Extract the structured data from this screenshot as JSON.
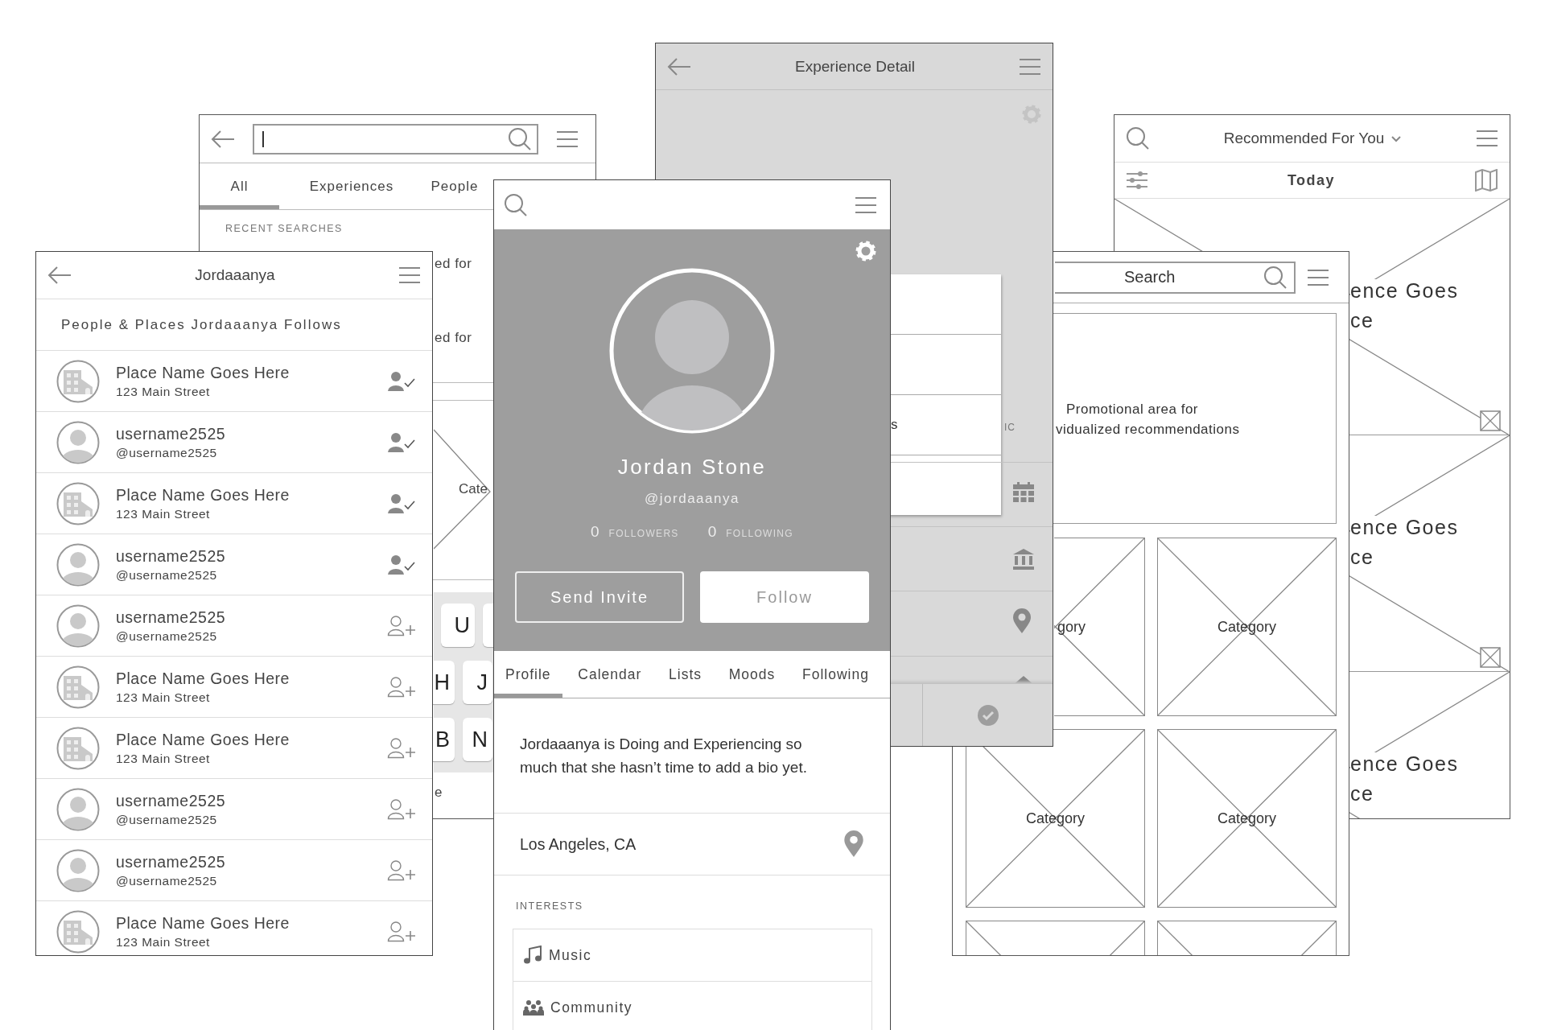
{
  "search_screen": {
    "tabs": [
      {
        "label": "All",
        "selected": true
      },
      {
        "label": "Experiences",
        "selected": false
      },
      {
        "label": "People",
        "selected": false
      }
    ],
    "section_label": "RECENT SEARCHES",
    "recent_fragments": [
      "ed for",
      "ed for"
    ],
    "category_fragment": "Cate",
    "keys": [
      {
        "label": "U"
      },
      {
        "label": "H"
      },
      {
        "label": "J"
      },
      {
        "label": "B"
      },
      {
        "label": "N"
      }
    ],
    "below_keyboard_fragment": "e"
  },
  "experience_detail": {
    "title": "Experience Detail",
    "list_fragment": "s",
    "side_fragment": "IC"
  },
  "recommended": {
    "title": "Recommended For You",
    "date": "Today",
    "cards": [
      {
        "lines": [
          "ence Goes",
          "ce"
        ]
      },
      {
        "lines": [
          "ence Goes",
          "ce"
        ]
      },
      {
        "lines": [
          "ence Goes",
          "ce"
        ]
      }
    ]
  },
  "search_screen_2": {
    "placeholder": "Search",
    "promo_lines": [
      "Promotional area for",
      "vidualized recommendations"
    ],
    "categories": [
      "gory",
      "Category",
      "Category",
      "Category"
    ]
  },
  "follows": {
    "title": "Jordaaanya",
    "heading": "People & Places Jordaaanya Follows",
    "rows": [
      {
        "kind": "place",
        "name": "Place Name Goes Here",
        "detail": "123 Main Street",
        "following": true
      },
      {
        "kind": "person",
        "name": "username2525",
        "detail": "@username2525",
        "following": true
      },
      {
        "kind": "place",
        "name": "Place Name Goes Here",
        "detail": "123 Main Street",
        "following": true
      },
      {
        "kind": "person",
        "name": "username2525",
        "detail": "@username2525",
        "following": true
      },
      {
        "kind": "person",
        "name": "username2525",
        "detail": "@username2525",
        "following": false
      },
      {
        "kind": "place",
        "name": "Place Name Goes Here",
        "detail": "123 Main Street",
        "following": false
      },
      {
        "kind": "place",
        "name": "Place Name Goes Here",
        "detail": "123 Main Street",
        "following": false
      },
      {
        "kind": "person",
        "name": "username2525",
        "detail": "@username2525",
        "following": false
      },
      {
        "kind": "person",
        "name": "username2525",
        "detail": "@username2525",
        "following": false
      },
      {
        "kind": "place",
        "name": "Place Name Goes Here",
        "detail": "123 Main Street",
        "following": false
      }
    ]
  },
  "profile": {
    "name": "Jordan Stone",
    "handle": "@jordaaanya",
    "stats": [
      {
        "count": "0",
        "label": "FOLLOWERS"
      },
      {
        "count": "0",
        "label": "FOLLOWING"
      }
    ],
    "buttons": [
      {
        "label": "Send Invite",
        "kind": "outline"
      },
      {
        "label": "Follow",
        "kind": "filled"
      }
    ],
    "tabs": [
      {
        "label": "Profile",
        "selected": true
      },
      {
        "label": "Calendar",
        "selected": false
      },
      {
        "label": "Lists",
        "selected": false
      },
      {
        "label": "Moods",
        "selected": false
      },
      {
        "label": "Following",
        "selected": false
      }
    ],
    "bio": "Jordaaanya is Doing and Experiencing so much that she hasn’t time to add a bio yet.",
    "location": "Los Angeles, CA",
    "interests_label": "INTERESTS",
    "interests": [
      {
        "kind": "music",
        "label": "Music"
      },
      {
        "kind": "community",
        "label": "Community"
      }
    ]
  }
}
